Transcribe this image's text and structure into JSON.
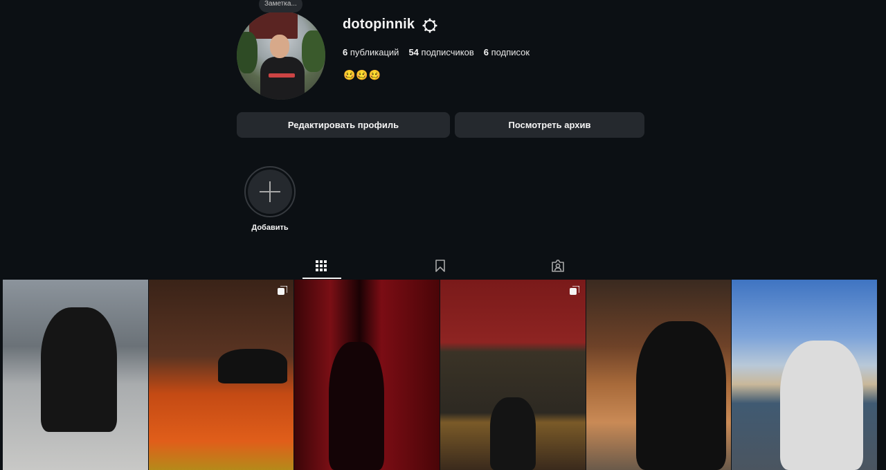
{
  "profile": {
    "note": "Заметка...",
    "username": "dotopinnik",
    "stats": {
      "posts_count": "6",
      "posts_label": "публикаций",
      "followers_count": "54",
      "followers_label": "подписчиков",
      "following_count": "6",
      "following_label": "подписок"
    },
    "bio": "🥴🥴🥴"
  },
  "buttons": {
    "edit_profile": "Редактировать профиль",
    "view_archive": "Посмотреть архив"
  },
  "highlights": {
    "add_label": "Добавить"
  },
  "tabs": [
    {
      "icon": "grid-icon",
      "active": true
    },
    {
      "icon": "bookmark-icon",
      "active": false
    },
    {
      "icon": "tagged-user-icon",
      "active": false
    }
  ],
  "posts": [
    {
      "index": 1,
      "multi": false
    },
    {
      "index": 2,
      "multi": true
    },
    {
      "index": 3,
      "multi": false
    },
    {
      "index": 4,
      "multi": true
    },
    {
      "index": 5,
      "multi": false
    },
    {
      "index": 6,
      "multi": false
    }
  ],
  "colors": {
    "background": "#0c1014",
    "button": "#25292e",
    "text": "#f5f5f5"
  }
}
